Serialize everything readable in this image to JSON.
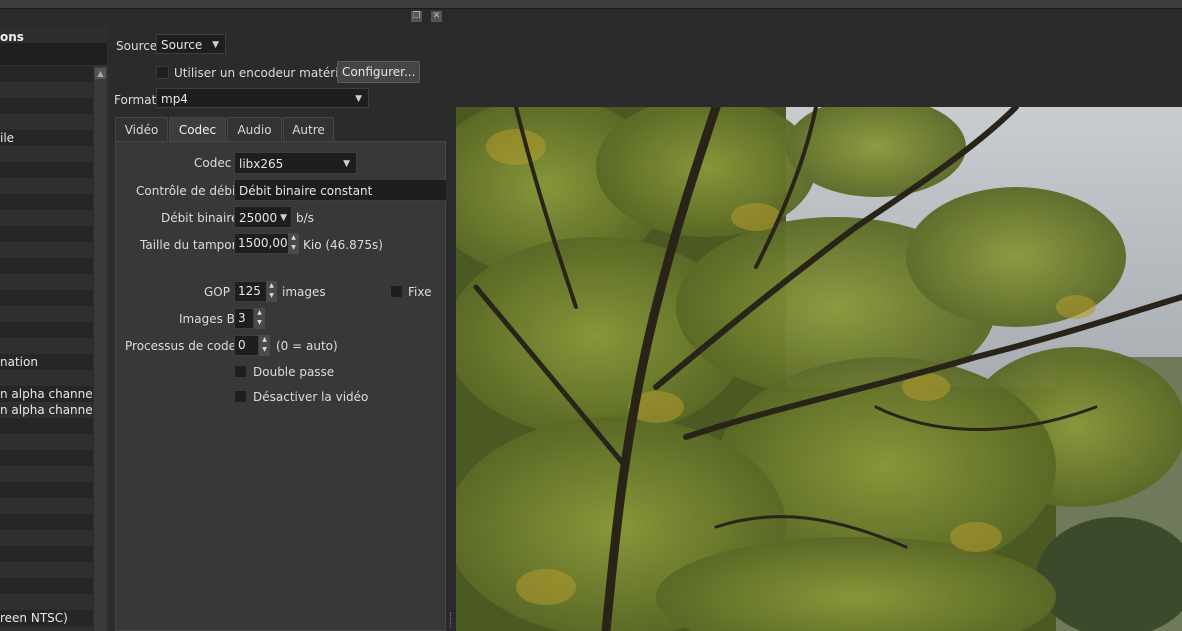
{
  "presets_panel": {
    "title": "ons",
    "items": [
      {
        "label": ""
      },
      {
        "label": ""
      },
      {
        "label": ""
      },
      {
        "label": ""
      },
      {
        "label": "ile"
      },
      {
        "label": ""
      },
      {
        "label": ""
      },
      {
        "label": ""
      },
      {
        "label": ""
      },
      {
        "label": ""
      },
      {
        "label": ""
      },
      {
        "label": ""
      },
      {
        "label": ""
      },
      {
        "label": ""
      },
      {
        "label": ""
      },
      {
        "label": ""
      },
      {
        "label": ""
      },
      {
        "label": ""
      },
      {
        "label": "nation"
      },
      {
        "label": ""
      },
      {
        "label": "n alpha channel"
      },
      {
        "label": "n alpha channel"
      },
      {
        "label": ""
      },
      {
        "label": ""
      },
      {
        "label": ""
      },
      {
        "label": ""
      },
      {
        "label": ""
      },
      {
        "label": ""
      },
      {
        "label": ""
      },
      {
        "label": ""
      },
      {
        "label": ""
      },
      {
        "label": ""
      },
      {
        "label": ""
      },
      {
        "label": ""
      },
      {
        "label": "reen NTSC)"
      }
    ]
  },
  "export": {
    "source_label": "Source",
    "source_value": "Source",
    "hw_encoder_label": "Utiliser un encodeur matériel",
    "configure_button": "Configurer...",
    "format_label": "Format",
    "format_value": "mp4",
    "tabs": [
      "Vidéo",
      "Codec",
      "Audio",
      "Autre"
    ],
    "active_tab": "Codec",
    "codec": {
      "codec_label": "Codec",
      "codec_value": "libx265",
      "rate_control_label": "Contrôle de débit",
      "rate_control_value": "Débit binaire constant",
      "bitrate_label": "Débit binaire",
      "bitrate_value": "25000",
      "bitrate_unit": "b/s",
      "buffer_label": "Taille du tampon",
      "buffer_value": "1500,00",
      "buffer_unit": "Kio (46.875s)",
      "gop_label": "GOP",
      "gop_value": "125",
      "gop_unit": "images",
      "fixed_label": "Fixe",
      "bframes_label": "Images B",
      "bframes_value": "3",
      "threads_label": "Processus de codec",
      "threads_value": "0",
      "threads_hint": "(0 = auto)",
      "two_pass_label": "Double passe",
      "disable_video_label": "Désactiver la vidéo"
    }
  },
  "colors": {
    "background": "#2b2b2b",
    "panel": "#383838",
    "field": "#1e1e1e"
  },
  "icons": {
    "dropdown": "chevron-down-icon",
    "spin": "spin-arrows-icon",
    "float": "float-window-icon",
    "close": "close-icon"
  }
}
